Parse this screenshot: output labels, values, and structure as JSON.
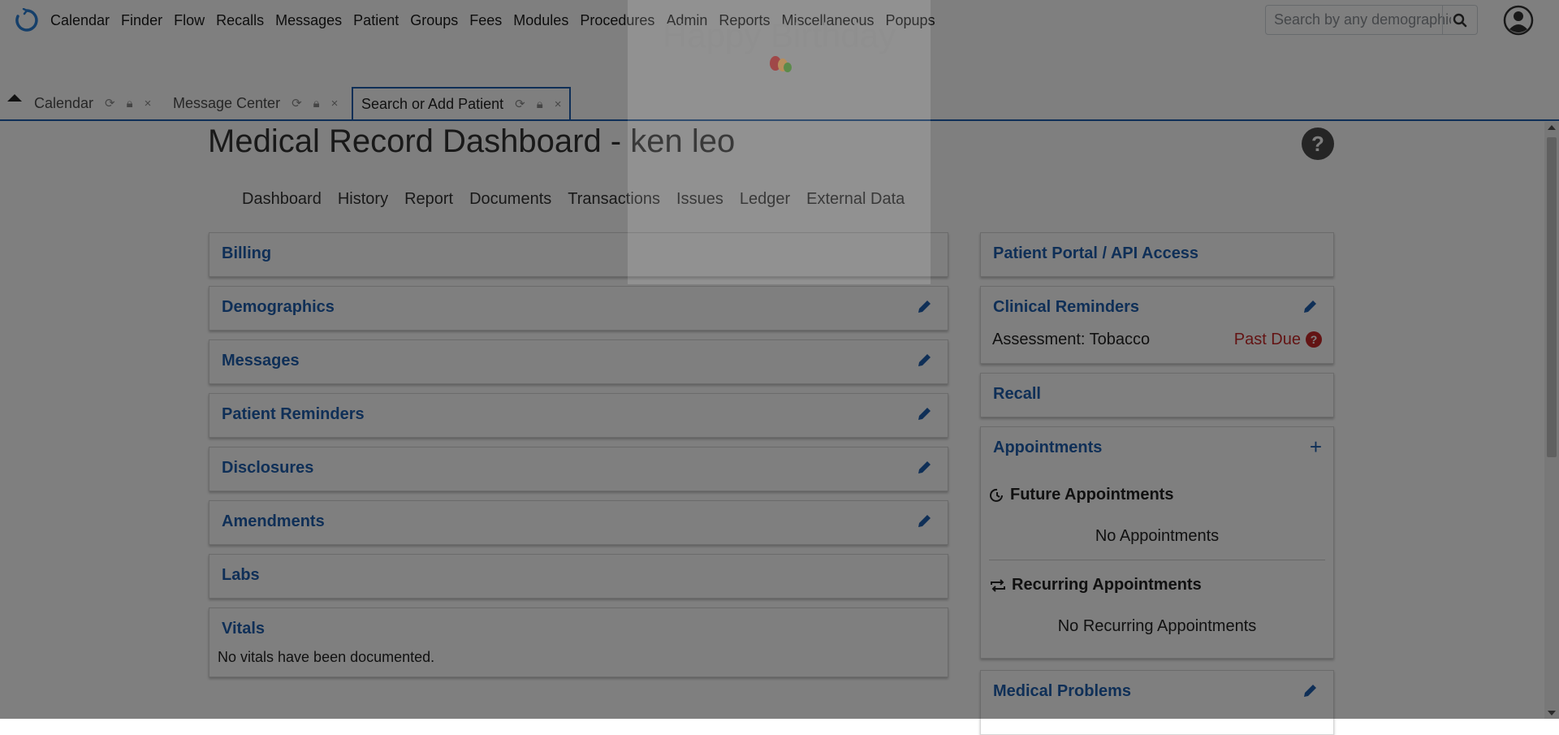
{
  "nav": {
    "items": [
      "Calendar",
      "Finder",
      "Flow",
      "Recalls",
      "Messages",
      "Patient",
      "Groups",
      "Fees",
      "Modules",
      "Procedures",
      "Admin",
      "Reports",
      "Miscellaneous",
      "Popups"
    ],
    "search_placeholder": "Search by any demographics"
  },
  "tabs": [
    {
      "label": "Calendar"
    },
    {
      "label": "Message Center"
    },
    {
      "label": "Search or Add Patient"
    }
  ],
  "dashboard": {
    "title": "Medical Record Dashboard - ken leo",
    "help": "?",
    "subnav": [
      "Dashboard",
      "History",
      "Report",
      "Documents",
      "Transactions",
      "Issues",
      "Ledger",
      "External Data"
    ]
  },
  "left_cards": {
    "billing": "Billing",
    "demographics": "Demographics",
    "messages": "Messages",
    "patient_reminders": "Patient Reminders",
    "disclosures": "Disclosures",
    "amendments": "Amendments",
    "labs": "Labs",
    "vitals": "Vitals",
    "vitals_empty": "No vitals have been documented."
  },
  "right_cards": {
    "portal": "Patient Portal / API Access",
    "clinical_reminders": "Clinical Reminders",
    "reminder_item": "Assessment: Tobacco",
    "reminder_status": "Past Due",
    "recall": "Recall",
    "appointments": "Appointments",
    "future_appts": "Future Appointments",
    "no_appts": "No Appointments",
    "recurring_appts": "Recurring Appointments",
    "no_recurring": "No Recurring Appointments",
    "medical_problems": "Medical Problems"
  },
  "popup": {
    "title": "Happy Birthday"
  },
  "colors": {
    "link_blue": "#1f5fae",
    "past_due_red": "#c62828",
    "overlay": "rgba(0,0,0,0.5)"
  }
}
